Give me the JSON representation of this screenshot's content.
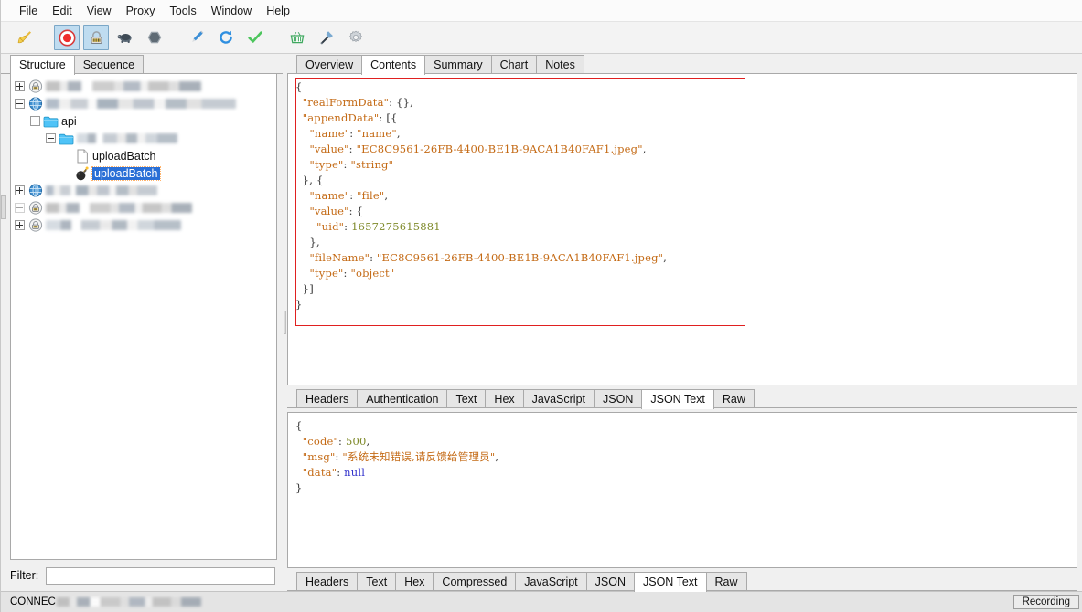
{
  "app": {
    "title": "Charles Proxy"
  },
  "menubar": {
    "items": [
      {
        "label": "File",
        "name": "menu-file"
      },
      {
        "label": "Edit",
        "name": "menu-edit"
      },
      {
        "label": "View",
        "name": "menu-view"
      },
      {
        "label": "Proxy",
        "name": "menu-proxy"
      },
      {
        "label": "Tools",
        "name": "menu-tools"
      },
      {
        "label": "Window",
        "name": "menu-window"
      },
      {
        "label": "Help",
        "name": "menu-help"
      }
    ]
  },
  "toolbar": {
    "buttons": [
      {
        "icon": "clear-broom-icon",
        "active": false
      },
      {
        "icon": "record-stop-icon",
        "active": true
      },
      {
        "icon": "ssl-proxying-icon",
        "active": true
      },
      {
        "icon": "throttle-turtle-icon",
        "active": false
      },
      {
        "icon": "breakpoints-hexagon-icon",
        "active": false
      },
      {
        "icon": "compose-pen-icon",
        "active": false
      },
      {
        "icon": "repeat-refresh-icon",
        "active": false
      },
      {
        "icon": "validate-check-icon",
        "active": false
      },
      {
        "icon": "basket-icon",
        "active": false
      },
      {
        "icon": "tools-wrench-icon",
        "active": false
      },
      {
        "icon": "settings-gear-icon",
        "active": false
      }
    ]
  },
  "sidebar": {
    "tabs": [
      {
        "label": "Structure",
        "selected": true
      },
      {
        "label": "Sequence",
        "selected": false
      }
    ],
    "tree": [
      {
        "indent": 0,
        "expander": "plus",
        "icon": "lock-icon",
        "label": "",
        "redacted": true,
        "redactWidth": 170,
        "blurStyle": "b1",
        "selected": false
      },
      {
        "indent": 0,
        "expander": "minus",
        "icon": "globe-icon",
        "label": "",
        "redacted": true,
        "redactWidth": 208,
        "blurStyle": "b2",
        "selected": false
      },
      {
        "indent": 1,
        "expander": "minus",
        "icon": "folder-icon",
        "label": "api",
        "redacted": false,
        "selected": false
      },
      {
        "indent": 2,
        "expander": "minus",
        "icon": "folder-icon",
        "label": "",
        "redacted": true,
        "redactWidth": 110,
        "blurStyle": "b3",
        "selected": false
      },
      {
        "indent": 3,
        "expander": "none",
        "icon": "document-icon",
        "label": "uploadBatch",
        "redacted": false,
        "selected": false
      },
      {
        "indent": 3,
        "expander": "none",
        "icon": "bomb-icon",
        "label": "uploadBatch",
        "redacted": false,
        "selected": true
      },
      {
        "indent": 0,
        "expander": "plus",
        "icon": "globe-icon",
        "label": "",
        "redacted": true,
        "redactWidth": 122,
        "blurStyle": "b2",
        "selected": false
      },
      {
        "indent": 0,
        "expander": "dotted",
        "icon": "lock-icon",
        "label": "",
        "redacted": true,
        "redactWidth": 160,
        "blurStyle": "b1",
        "selected": false
      },
      {
        "indent": 0,
        "expander": "plus",
        "icon": "lock-icon",
        "label": "",
        "redacted": true,
        "redactWidth": 148,
        "blurStyle": "b3",
        "selected": false
      }
    ],
    "filter": {
      "label": "Filter:",
      "value": "",
      "placeholder": ""
    }
  },
  "request": {
    "tabs": [
      {
        "label": "Overview",
        "selected": false
      },
      {
        "label": "Contents",
        "selected": true
      },
      {
        "label": "Summary",
        "selected": false
      },
      {
        "label": "Chart",
        "selected": false
      },
      {
        "label": "Notes",
        "selected": false
      }
    ],
    "view_tabs": [
      {
        "label": "Headers",
        "selected": false
      },
      {
        "label": "Authentication",
        "selected": false
      },
      {
        "label": "Text",
        "selected": false
      },
      {
        "label": "Hex",
        "selected": false
      },
      {
        "label": "JavaScript",
        "selected": false
      },
      {
        "label": "JSON",
        "selected": false
      },
      {
        "label": "JSON Text",
        "selected": true
      },
      {
        "label": "Raw",
        "selected": false
      }
    ],
    "body_lines": [
      [
        {
          "t": "p",
          "v": "{"
        }
      ],
      [
        {
          "t": "p",
          "v": "  "
        },
        {
          "t": "k",
          "v": "\"realFormData\""
        },
        {
          "t": "p",
          "v": ": {},"
        }
      ],
      [
        {
          "t": "p",
          "v": "  "
        },
        {
          "t": "k",
          "v": "\"appendData\""
        },
        {
          "t": "p",
          "v": ": [{"
        }
      ],
      [
        {
          "t": "p",
          "v": "    "
        },
        {
          "t": "k",
          "v": "\"name\""
        },
        {
          "t": "p",
          "v": ": "
        },
        {
          "t": "s",
          "v": "\"name\""
        },
        {
          "t": "p",
          "v": ","
        }
      ],
      [
        {
          "t": "p",
          "v": "    "
        },
        {
          "t": "k",
          "v": "\"value\""
        },
        {
          "t": "p",
          "v": ": "
        },
        {
          "t": "s",
          "v": "\"EC8C9561-26FB-4400-BE1B-9ACA1B40FAF1.jpeg\""
        },
        {
          "t": "p",
          "v": ","
        }
      ],
      [
        {
          "t": "p",
          "v": "    "
        },
        {
          "t": "k",
          "v": "\"type\""
        },
        {
          "t": "p",
          "v": ": "
        },
        {
          "t": "s",
          "v": "\"string\""
        }
      ],
      [
        {
          "t": "p",
          "v": "  }, {"
        }
      ],
      [
        {
          "t": "p",
          "v": "    "
        },
        {
          "t": "k",
          "v": "\"name\""
        },
        {
          "t": "p",
          "v": ": "
        },
        {
          "t": "s",
          "v": "\"file\""
        },
        {
          "t": "p",
          "v": ","
        }
      ],
      [
        {
          "t": "p",
          "v": "    "
        },
        {
          "t": "k",
          "v": "\"value\""
        },
        {
          "t": "p",
          "v": ": {"
        }
      ],
      [
        {
          "t": "p",
          "v": "      "
        },
        {
          "t": "k",
          "v": "\"uid\""
        },
        {
          "t": "p",
          "v": ": "
        },
        {
          "t": "n",
          "v": "1657275615881"
        }
      ],
      [
        {
          "t": "p",
          "v": "    },"
        }
      ],
      [
        {
          "t": "p",
          "v": "    "
        },
        {
          "t": "k",
          "v": "\"fileName\""
        },
        {
          "t": "p",
          "v": ": "
        },
        {
          "t": "s",
          "v": "\"EC8C9561-26FB-4400-BE1B-9ACA1B40FAF1.jpeg\""
        },
        {
          "t": "p",
          "v": ","
        }
      ],
      [
        {
          "t": "p",
          "v": "    "
        },
        {
          "t": "k",
          "v": "\"type\""
        },
        {
          "t": "p",
          "v": ": "
        },
        {
          "t": "s",
          "v": "\"object\""
        }
      ],
      [
        {
          "t": "p",
          "v": "  }]"
        }
      ],
      [
        {
          "t": "p",
          "v": "}"
        }
      ]
    ]
  },
  "response": {
    "view_tabs": [
      {
        "label": "Headers",
        "selected": false
      },
      {
        "label": "Text",
        "selected": false
      },
      {
        "label": "Hex",
        "selected": false
      },
      {
        "label": "Compressed",
        "selected": false
      },
      {
        "label": "JavaScript",
        "selected": false
      },
      {
        "label": "JSON",
        "selected": false
      },
      {
        "label": "JSON Text",
        "selected": true
      },
      {
        "label": "Raw",
        "selected": false
      }
    ],
    "body_lines": [
      [
        {
          "t": "p",
          "v": "{"
        }
      ],
      [
        {
          "t": "p",
          "v": "  "
        },
        {
          "t": "k",
          "v": "\"code\""
        },
        {
          "t": "p",
          "v": ": "
        },
        {
          "t": "n",
          "v": "500"
        },
        {
          "t": "p",
          "v": ","
        }
      ],
      [
        {
          "t": "p",
          "v": "  "
        },
        {
          "t": "k",
          "v": "\"msg\""
        },
        {
          "t": "p",
          "v": ": "
        },
        {
          "t": "s",
          "v": "\"系统未知错误,请反馈给管理员\""
        },
        {
          "t": "p",
          "v": ","
        }
      ],
      [
        {
          "t": "p",
          "v": "  "
        },
        {
          "t": "k",
          "v": "\"data\""
        },
        {
          "t": "p",
          "v": ": "
        },
        {
          "t": "nl",
          "v": "null"
        }
      ],
      [
        {
          "t": "p",
          "v": "}"
        }
      ]
    ]
  },
  "statusbar": {
    "connection_prefix": "CONNEC",
    "connection_redacted": true,
    "recording_label": "Recording"
  },
  "colors": {
    "json_key": "#c46a15",
    "json_string": "#c46a15",
    "json_number": "#7f8a2a",
    "json_null": "#3333cc",
    "selection_blue": "#2a6fd6",
    "highlight_box_red": "#e02020",
    "toolbar_active": "#bfdcf0"
  }
}
